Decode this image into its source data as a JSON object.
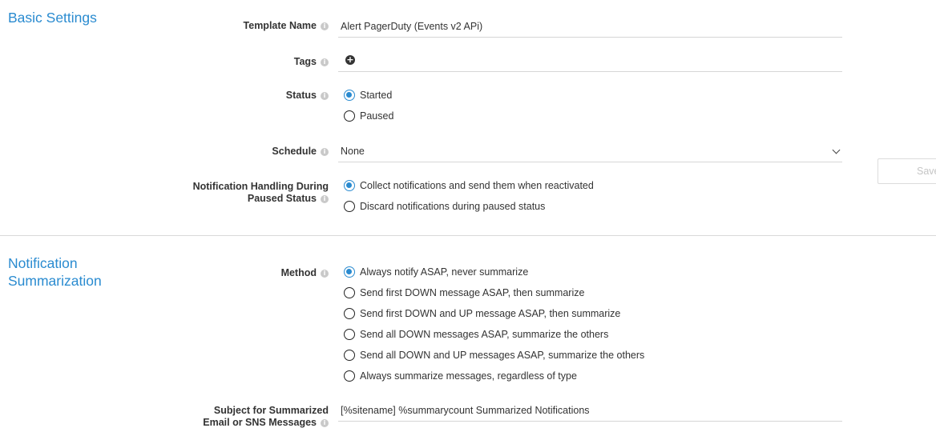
{
  "basic_settings": {
    "title": "Basic Settings",
    "template_name": {
      "label": "Template Name",
      "value": "Alert PagerDuty (Events v2 APi)"
    },
    "tags": {
      "label": "Tags"
    },
    "status": {
      "label": "Status",
      "options": [
        "Started",
        "Paused"
      ],
      "selected": "Started"
    },
    "schedule": {
      "label": "Schedule",
      "value": "None"
    },
    "paused_handling": {
      "label_line1": "Notification Handling During",
      "label_line2": "Paused Status",
      "options": [
        "Collect notifications and send them when reactivated",
        "Discard notifications during paused status"
      ],
      "selected": "Collect notifications and send them when reactivated"
    }
  },
  "save_button": {
    "label": "Save"
  },
  "notification_summarization": {
    "title_line1": "Notification",
    "title_line2": "Summarization",
    "method": {
      "label": "Method",
      "options": [
        "Always notify ASAP, never summarize",
        "Send first DOWN message ASAP, then summarize",
        "Send first DOWN and UP message ASAP, then summarize",
        "Send all DOWN messages ASAP, summarize the others",
        "Send all DOWN and UP messages ASAP, summarize the others",
        "Always summarize messages, regardless of type"
      ],
      "selected": "Always notify ASAP, never summarize"
    },
    "subject": {
      "label_line1": "Subject for Summarized",
      "label_line2": "Email or SNS Messages",
      "value": "[%sitename] %summarycount Summarized Notifications"
    }
  },
  "icons": {
    "info": "info-icon",
    "add": "plus-circle-icon",
    "dropdown": "chevron-down-icon"
  }
}
